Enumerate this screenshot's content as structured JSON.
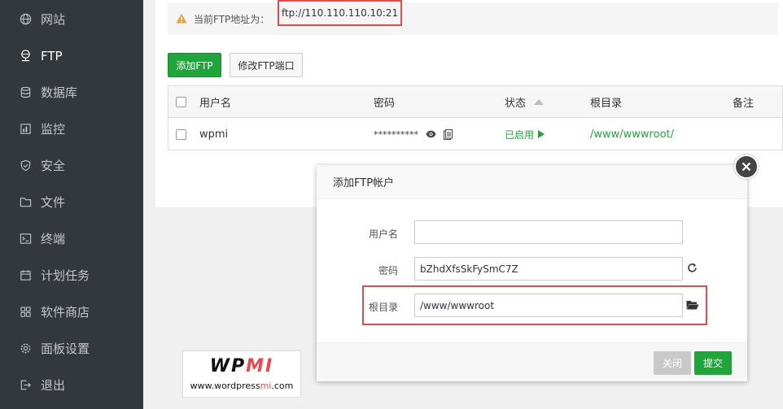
{
  "sidebar": {
    "items": [
      {
        "label": "网站",
        "icon": "globe-icon",
        "active": false
      },
      {
        "label": "FTP",
        "icon": "ftp-icon",
        "active": true
      },
      {
        "label": "数据库",
        "icon": "database-icon",
        "active": false
      },
      {
        "label": "监控",
        "icon": "monitor-icon",
        "active": false
      },
      {
        "label": "安全",
        "icon": "shield-icon",
        "active": false
      },
      {
        "label": "文件",
        "icon": "folder-icon",
        "active": false
      },
      {
        "label": "终端",
        "icon": "terminal-icon",
        "active": false
      },
      {
        "label": "计划任务",
        "icon": "calendar-icon",
        "active": false
      },
      {
        "label": "软件商店",
        "icon": "apps-icon",
        "active": false
      },
      {
        "label": "面板设置",
        "icon": "gear-icon",
        "active": false
      },
      {
        "label": "退出",
        "icon": "logout-icon",
        "active": false
      }
    ]
  },
  "notice": {
    "label": "当前FTP地址为：",
    "address": "ftp://110.110.110.10:21"
  },
  "toolbar": {
    "add_label": "添加FTP",
    "port_label": "修改FTP端口"
  },
  "table": {
    "headers": {
      "username": "用户名",
      "password": "密码",
      "status": "状态",
      "root": "根目录",
      "note": "备注"
    },
    "rows": [
      {
        "username": "wpmi",
        "password": "**********",
        "status": "已启用",
        "root": "/www/wwwroot/"
      }
    ]
  },
  "modal": {
    "title": "添加FTP帐户",
    "username_label": "用户名",
    "username_value": "",
    "password_label": "密码",
    "password_value": "bZhdXfsSkFySmC7Z",
    "root_label": "根目录",
    "root_value": "/www/wwwroot",
    "close_label": "关闭",
    "submit_label": "提交"
  },
  "watermark": {
    "logo_part1": "WP",
    "logo_part2": "MI",
    "url_part1": "www.wordpress",
    "url_part2": "mi",
    "url_part3": ".com"
  },
  "colors": {
    "sidebar_bg": "#33383d",
    "accent_green": "#20a53a",
    "highlight_red": "#e8494c"
  }
}
